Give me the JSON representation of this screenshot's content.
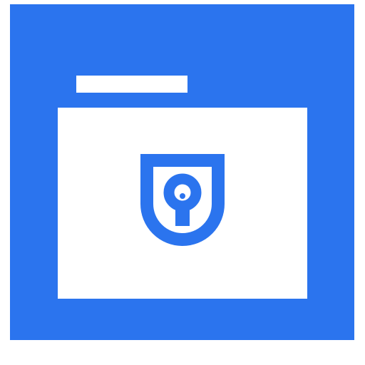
{
  "icon": {
    "name": "secure-folder-icon",
    "colors": {
      "tile": "#2b74ee",
      "folder": "#ffffff",
      "shield": "#2b74ee"
    },
    "parts": [
      "folder-tab",
      "folder-body",
      "shield-icon",
      "keyhole-icon"
    ]
  }
}
